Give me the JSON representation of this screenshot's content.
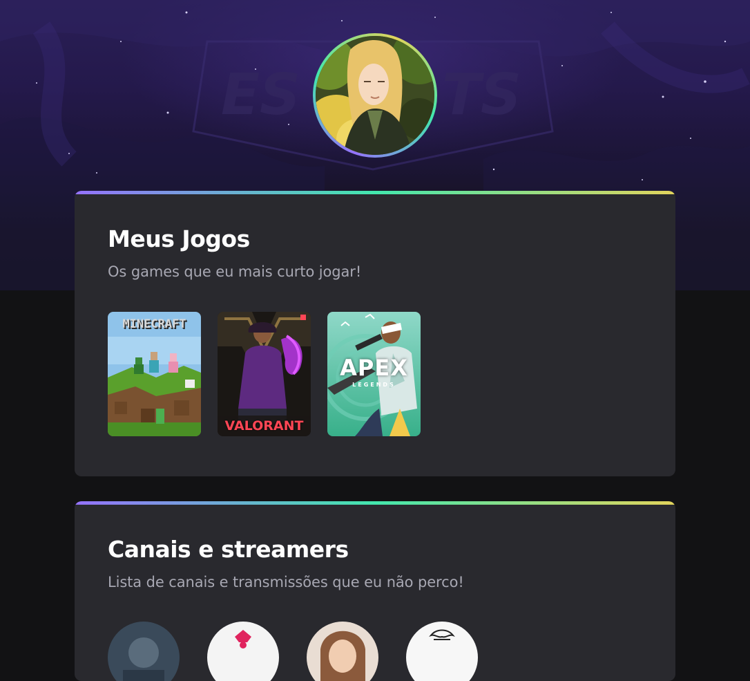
{
  "profile": {
    "avatar_alt": "Foto de perfil"
  },
  "games_section": {
    "title": "Meus Jogos",
    "subtitle": "Os games que eu mais curto jogar!",
    "games": [
      {
        "name": "Minecraft",
        "cover_text": "MINECRAFT"
      },
      {
        "name": "Valorant",
        "cover_text": "VALORANT"
      },
      {
        "name": "Apex Legends",
        "cover_text": "APEX",
        "cover_subtext": "LEGENDS"
      }
    ]
  },
  "channels_section": {
    "title": "Canais e streamers",
    "subtitle": "Lista de canais e transmissões que eu não perco!",
    "channels": [
      {
        "id": "channel-1",
        "color": "#3a4a5a"
      },
      {
        "id": "channel-2",
        "color": "#f4f4f4"
      },
      {
        "id": "channel-3",
        "color": "#8b5a3c"
      },
      {
        "id": "channel-4",
        "color": "#f7f7f7"
      }
    ]
  },
  "theme": {
    "background": "#121214",
    "card": "#29292e",
    "title": "#ffffff",
    "subtitle": "#a8a8b3",
    "gradient": [
      "#9572fc",
      "#43e7ad",
      "#e2d45c"
    ]
  }
}
